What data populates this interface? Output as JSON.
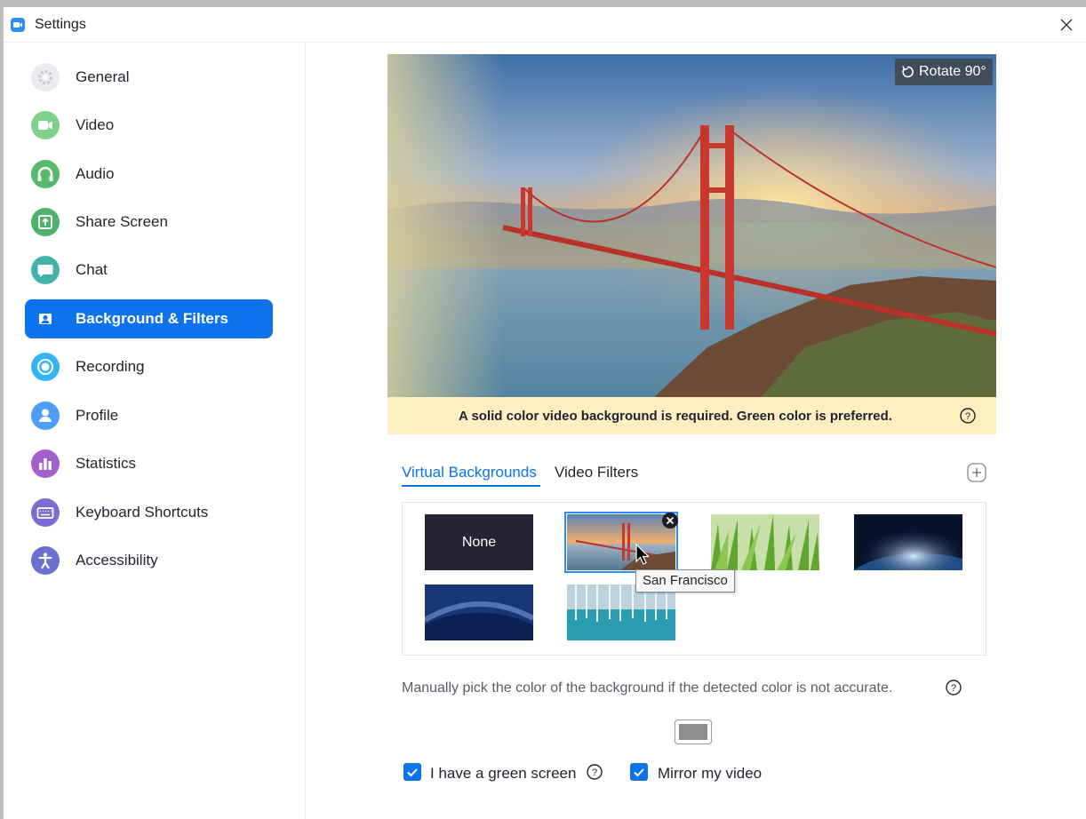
{
  "window": {
    "title": "Settings"
  },
  "sidebar": {
    "items": [
      {
        "label": "General",
        "icon": "gear-icon",
        "color": "#e9e9ee",
        "active": false
      },
      {
        "label": "Video",
        "icon": "video-camera-icon",
        "color": "#7ed08a",
        "active": false
      },
      {
        "label": "Audio",
        "icon": "headphones-icon",
        "color": "#58b86c",
        "active": false
      },
      {
        "label": "Share Screen",
        "icon": "share-screen-icon",
        "color": "#4db36b",
        "active": false
      },
      {
        "label": "Chat",
        "icon": "chat-bubble-icon",
        "color": "#43b3a8",
        "active": false
      },
      {
        "label": "Background & Filters",
        "icon": "portrait-icon",
        "color": "#0e72ed",
        "active": true
      },
      {
        "label": "Recording",
        "icon": "record-icon",
        "color": "#33b5f5",
        "active": false
      },
      {
        "label": "Profile",
        "icon": "user-icon",
        "color": "#4c9ef7",
        "active": false
      },
      {
        "label": "Statistics",
        "icon": "bar-chart-icon",
        "color": "#a45fcf",
        "active": false
      },
      {
        "label": "Keyboard Shortcuts",
        "icon": "keyboard-icon",
        "color": "#7e6bd1",
        "active": false
      },
      {
        "label": "Accessibility",
        "icon": "accessibility-icon",
        "color": "#6b6fd1",
        "active": false
      }
    ]
  },
  "preview": {
    "rotate_label": "Rotate 90°",
    "warning": "A solid color video background is required. Green color is preferred."
  },
  "tabs": {
    "virtual": "Virtual Backgrounds",
    "filters": "Video Filters"
  },
  "gallery": {
    "none_label": "None",
    "tooltip": "San Francisco"
  },
  "options": {
    "hint": "Manually pick the color of the background if the detected color is not accurate.",
    "green_screen": "I have a green screen",
    "mirror": "Mirror my video",
    "picked_color": "#8f8f8f",
    "accent": "#0e72ed",
    "warning_bg": "#fdefbf"
  }
}
